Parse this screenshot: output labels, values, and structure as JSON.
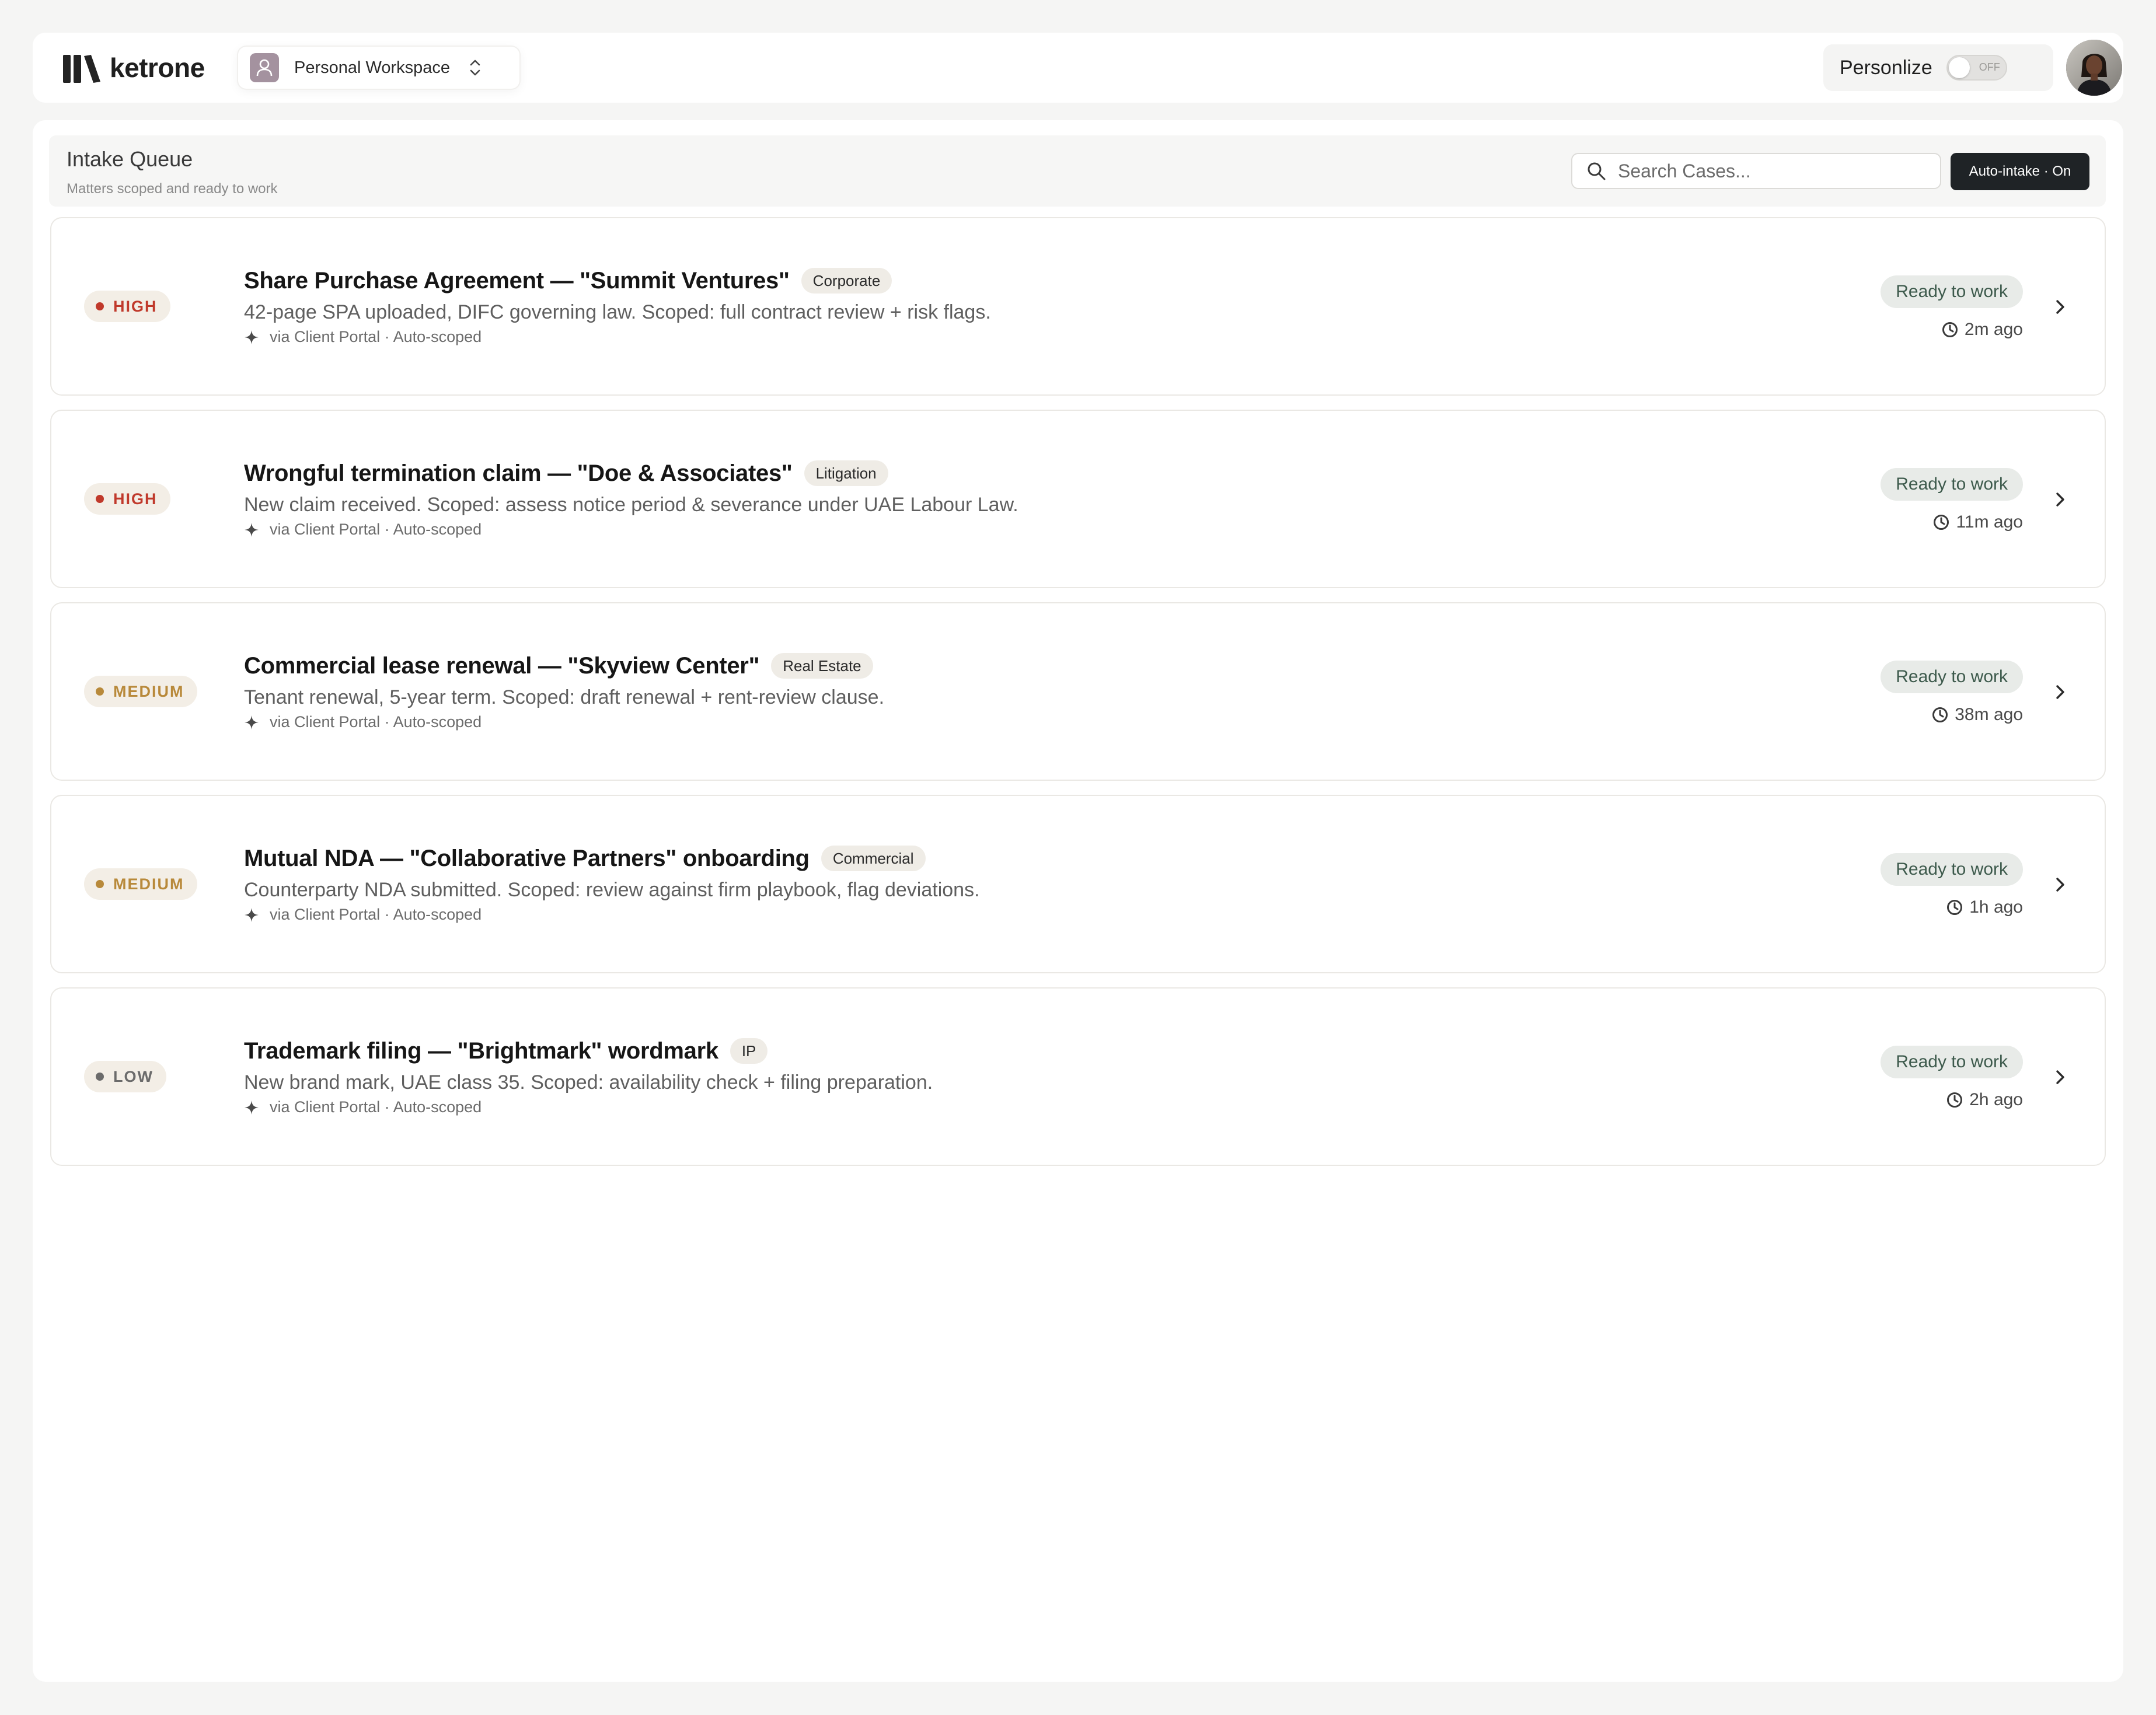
{
  "app": {
    "brand": "ketrone",
    "workspace_label": "Personal Workspace",
    "personalize_label": "Personlize",
    "personalize_toggle": "OFF"
  },
  "queue": {
    "title": "Intake Queue",
    "subtitle": "Matters scoped and ready to work",
    "search_placeholder": "Search Cases...",
    "auto_intake_label": "Auto-intake · On"
  },
  "colors": {
    "high": "#c0392b",
    "medium": "#b8893a",
    "low": "#6b6b6b",
    "status_bg": "#e8ebe8",
    "status_text": "#3d5a4c"
  },
  "cases": [
    {
      "priority": "HIGH",
      "title": "Share Purchase Agreement — \"Summit Ventures\"",
      "tag": "Corporate",
      "description": "42-page SPA uploaded, DIFC governing law. Scoped: full contract review + risk flags.",
      "meta": "via Client Portal · Auto-scoped",
      "status": "Ready to work",
      "time": "2m ago"
    },
    {
      "priority": "HIGH",
      "title": "Wrongful termination claim — \"Doe & Associates\"",
      "tag": "Litigation",
      "description": "New claim received. Scoped: assess notice period & severance under UAE Labour Law.",
      "meta": "via Client Portal · Auto-scoped",
      "status": "Ready to work",
      "time": "11m ago"
    },
    {
      "priority": "MEDIUM",
      "title": "Commercial lease renewal — \"Skyview Center\"",
      "tag": "Real Estate",
      "description": "Tenant renewal, 5-year term. Scoped: draft renewal + rent-review clause.",
      "meta": "via Client Portal · Auto-scoped",
      "status": "Ready to work",
      "time": "38m ago"
    },
    {
      "priority": "MEDIUM",
      "title": "Mutual NDA — \"Collaborative Partners\" onboarding",
      "tag": "Commercial",
      "description": "Counterparty NDA submitted. Scoped: review against firm playbook, flag deviations.",
      "meta": "via Client Portal · Auto-scoped",
      "status": "Ready to work",
      "time": "1h ago"
    },
    {
      "priority": "LOW",
      "title": "Trademark filing — \"Brightmark\" wordmark",
      "tag": "IP",
      "description": "New brand mark, UAE class 35. Scoped: availability check + filing preparation.",
      "meta": "via Client Portal · Auto-scoped",
      "status": "Ready to work",
      "time": "2h ago"
    }
  ]
}
